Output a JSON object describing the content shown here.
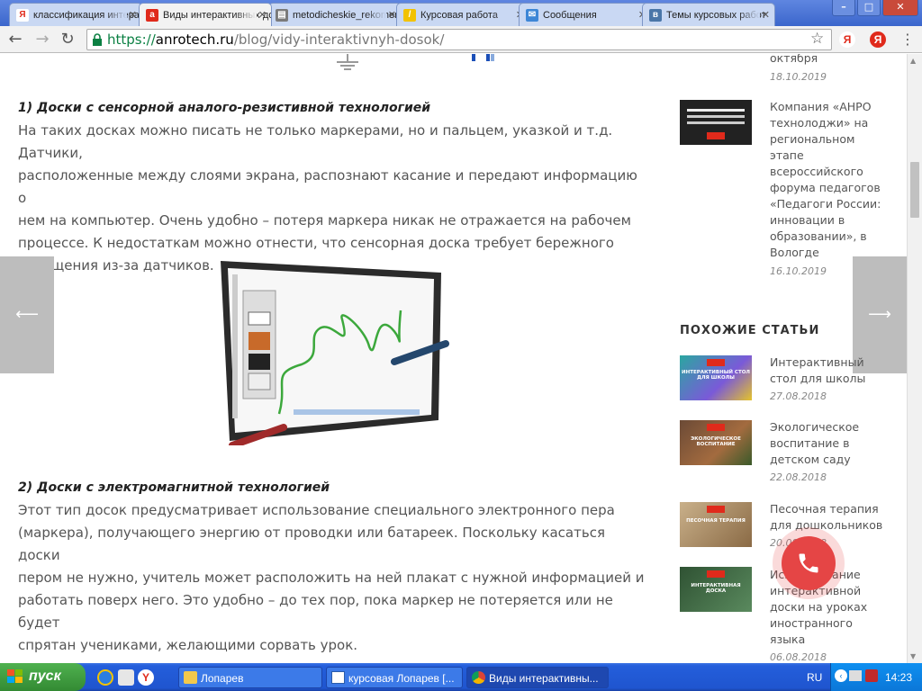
{
  "tabs": [
    {
      "label": "классификация интерактивных",
      "icon": "yandex-icon",
      "color": "#ffffff",
      "fg": "#e02a1b"
    },
    {
      "label": "Виды интерактивных досок",
      "icon": "anro-icon",
      "color": "#e02a1b",
      "fg": "#ffffff"
    },
    {
      "label": "metodicheskie_rekomendacii",
      "icon": "document-icon",
      "color": "#7a7a7a",
      "fg": "#ffffff"
    },
    {
      "label": "Курсовая работа",
      "icon": "pencil-icon",
      "color": "#f2c200",
      "fg": "#ffffff"
    },
    {
      "label": "Сообщения",
      "icon": "message-icon",
      "color": "#3d86d6",
      "fg": "#ffffff"
    },
    {
      "label": "Темы курсовых работ",
      "icon": "vk-icon",
      "color": "#4a76a8",
      "fg": "#ffffff"
    }
  ],
  "window": {
    "minimize": "–",
    "maximize": "□",
    "close": "✕"
  },
  "address": {
    "scheme": "https://",
    "host": "anrotech.ru",
    "path": "/blog/vidy-interaktivnyh-dosok/"
  },
  "toolbar_ext": {
    "ya1": "Я",
    "ya2": "Я"
  },
  "article": {
    "h1": "1) Доски с сенсорной аналого-резистивной технологией",
    "p1": [
      "На таких досках можно писать не только маркерами, но и пальцем, указкой и т.д. Датчики,",
      "расположенные между слоями экрана, распознают касание и передают информацию о",
      "нем на компьютер. Очень удобно – потеря маркера никак не отражается на рабочем",
      "процессе. К недостаткам можно отнести, что сенсорная доска требует бережного",
      "обращения из-за датчиков."
    ],
    "h2": "2) Доски с электромагнитной технологией",
    "p2": [
      "Этот тип досок предусматривает использование специального электронного пера",
      "(маркера), получающего энергию от проводки или батареек. Поскольку касаться доски",
      "пером не нужно, учитель может расположить на ней плакат с нужной информацией и",
      "работать поверх него. Это удобно – до тех пор, пока маркер не потеряется или не будет",
      "спрятан учениками, желающими сорвать урок."
    ]
  },
  "nav": {
    "prev": "⟵",
    "next": "⟶"
  },
  "sidebar": {
    "news": [
      {
        "title_lines": [
          "октября"
        ],
        "date": "18.10.2019"
      },
      {
        "title_lines": [
          "Компания «АНРО",
          "технолоджи» на",
          "региональном",
          "этапе",
          "всероссийского",
          "форума педагогов",
          "«Педагоги России:",
          "инновации в",
          "образовании», в",
          "Вологде"
        ],
        "date": "16.10.2019"
      }
    ],
    "similar_heading": "ПОХОЖИЕ СТАТЬИ",
    "similar": [
      {
        "title_lines": [
          "Интерактивный",
          "стол для школы"
        ],
        "date": "27.08.2018",
        "thumb_text": "ИНТЕРАКТИВНЫЙ СТОЛ ДЛЯ ШКОЛЫ",
        "bg": "#2aa7a0"
      },
      {
        "title_lines": [
          "Экологическое",
          "воспитание в",
          "детском саду"
        ],
        "date": "22.08.2018",
        "thumb_text": "ЭКОЛОГИЧЕСКОЕ ВОСПИТАНИЕ",
        "bg": "#6b4a36"
      },
      {
        "title_lines": [
          "Песочная терапия",
          "для дошкольников"
        ],
        "date": "20.08.2018",
        "thumb_text": "ПЕСОЧНАЯ ТЕРАПИЯ",
        "bg": "#a98862"
      },
      {
        "title_lines": [
          "Использование",
          "интерактивной",
          "доски на уроках",
          "иностранного",
          "языка"
        ],
        "date": "06.08.2018",
        "thumb_text": "ИНТЕРАКТИВНАЯ ДОСКА",
        "bg": "#3d6b44"
      }
    ]
  },
  "taskbar": {
    "start": "пуск",
    "tasks": [
      "Лопарев",
      "курсовая Лопарев [...",
      "Виды интерактивны..."
    ],
    "lang": "RU",
    "time": "14:23"
  }
}
